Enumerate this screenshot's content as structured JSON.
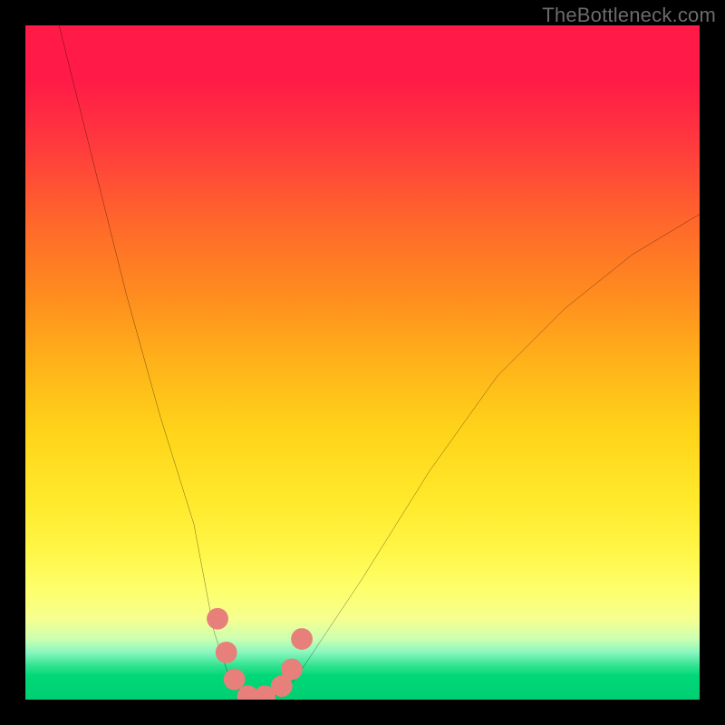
{
  "watermark": "TheBottleneck.com",
  "chart_data": {
    "type": "line",
    "title": "",
    "xlabel": "",
    "ylabel": "",
    "xlim": [
      0,
      100
    ],
    "ylim": [
      0,
      100
    ],
    "grid": false,
    "legend": false,
    "series": [
      {
        "name": "bottleneck-curve",
        "x": [
          5,
          10,
          15,
          20,
          25,
          28,
          30,
          32,
          34,
          36,
          38,
          40,
          50,
          60,
          70,
          80,
          90,
          100
        ],
        "y": [
          100,
          80,
          60,
          42,
          26,
          10,
          4,
          1,
          0,
          0,
          1,
          3,
          18,
          34,
          48,
          58,
          66,
          72
        ]
      }
    ],
    "markers": [
      {
        "name": "marker-left-1",
        "x": 28.5,
        "y": 12
      },
      {
        "name": "marker-left-2",
        "x": 29.8,
        "y": 7
      },
      {
        "name": "marker-left-3",
        "x": 31.0,
        "y": 3
      },
      {
        "name": "marker-floor-1",
        "x": 33.0,
        "y": 0.5
      },
      {
        "name": "marker-floor-2",
        "x": 35.5,
        "y": 0.5
      },
      {
        "name": "marker-right-1",
        "x": 38.0,
        "y": 2
      },
      {
        "name": "marker-right-2",
        "x": 39.5,
        "y": 4.5
      },
      {
        "name": "marker-right-3",
        "x": 41.0,
        "y": 9
      }
    ],
    "colors": {
      "curve": "#000000",
      "marker": "#e77f7a",
      "gradient_top": "#ff1a47",
      "gradient_bottom": "#00cf73"
    }
  }
}
